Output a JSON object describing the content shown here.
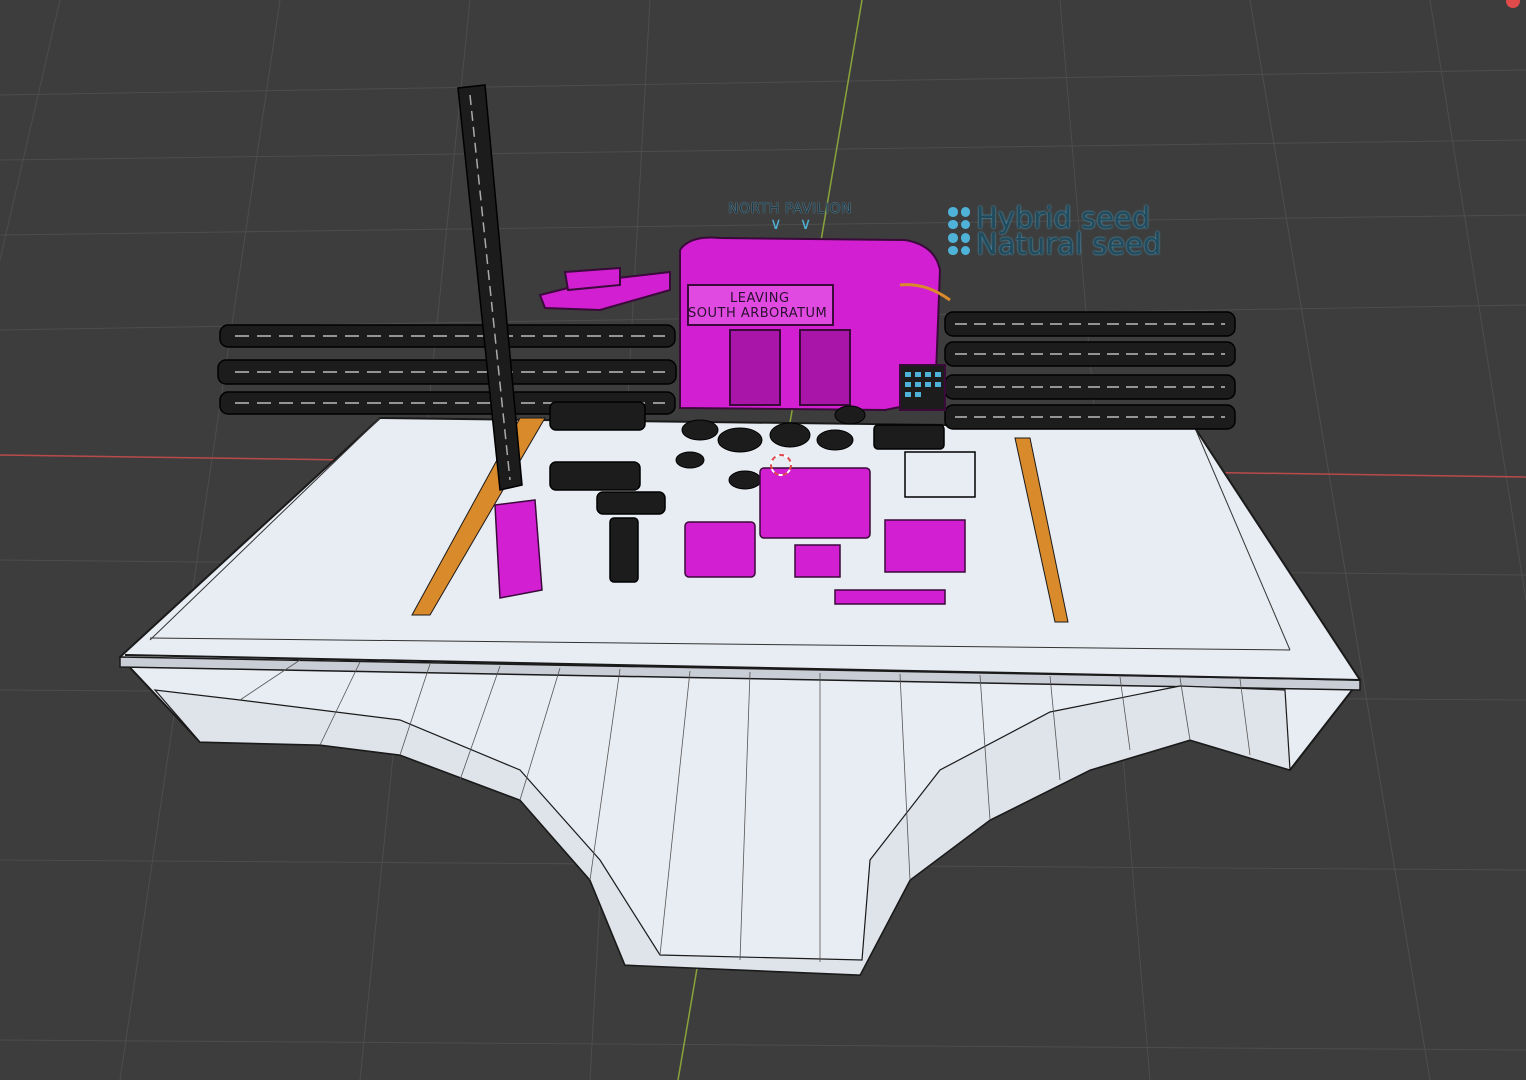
{
  "app": {
    "name": "3D viewport",
    "background_color": "#3d3d3d"
  },
  "colors": {
    "grid": "#4a4a4a",
    "x_axis": "#b84a4a",
    "y_axis": "#8aa33a",
    "floor": "#e8ecf3",
    "floor_edge": "#1a1a1a",
    "selected": "#d11fd1",
    "unselected": "#1c1c1c",
    "orange_strip": "#d98a2b",
    "text_object": "#4fb3d9"
  },
  "scene": {
    "north_label": "NORTH PAVILION",
    "north_arrows": "∨∨",
    "legend": [
      {
        "label": "Hybrid seed",
        "icon": "dots-icon"
      },
      {
        "label": "Natural seed",
        "icon": "dots-icon"
      }
    ],
    "sign_line1": "LEAVING",
    "sign_line2": "SOUTH ARBORATUM"
  }
}
